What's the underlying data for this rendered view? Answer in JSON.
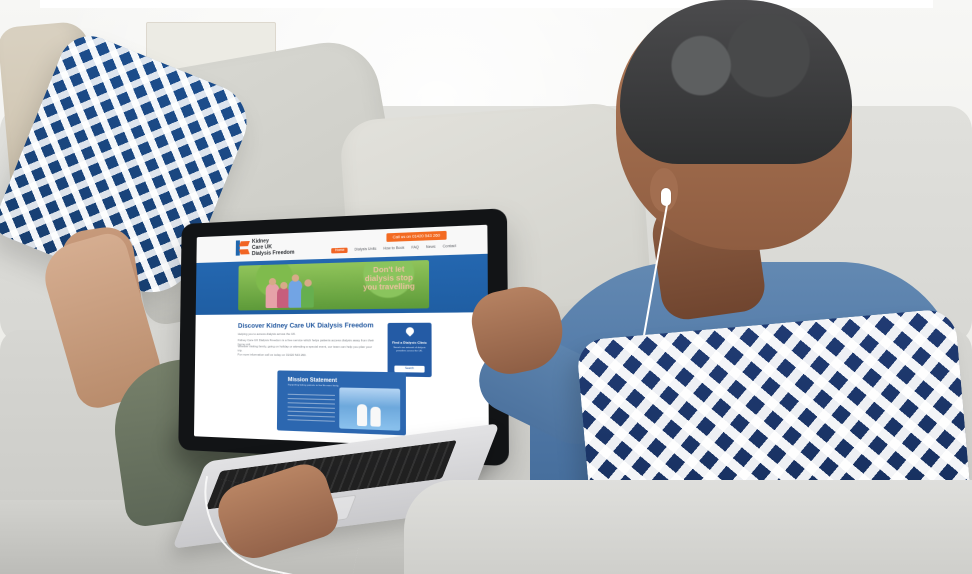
{
  "website": {
    "logo": {
      "line1": "Kidney",
      "line2": "Care UK",
      "line3": "Dialysis Freedom"
    },
    "top_button": "Call us on 01420 543 260",
    "nav": [
      "Home",
      "Dialysis Units",
      "How to Book",
      "FAQ",
      "News",
      "Contact"
    ],
    "hero_text": "Don't let dialysis stop you travelling",
    "title": "Discover Kidney Care UK Dialysis Freedom",
    "intro": "Helping you to access dialysis across the UK.",
    "paragraph_2": "Kidney Care UK Dialysis Freedom is a free service which helps patients access dialysis away from their home unit.",
    "paragraph_3": "Whether visiting family, going on holiday or attending a special event, our team can help you plan your trip.",
    "paragraph_4": "For more information call us today on 01420 543 260.",
    "find_card": {
      "title": "Find a Dialysis Clinic",
      "text": "Search our network of dialysis providers across the UK.",
      "button": "Search"
    },
    "mission": {
      "title": "Mission Statement",
      "subtitle": "Supporting kidney patients to live life more freely."
    }
  }
}
